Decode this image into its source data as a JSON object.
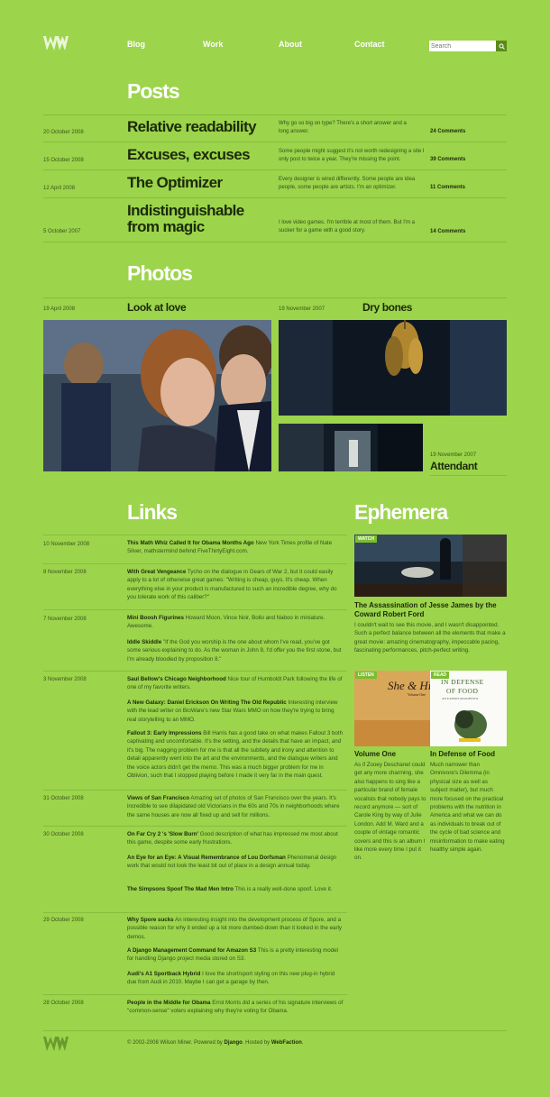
{
  "header": {
    "nav": [
      "Blog",
      "Work",
      "About",
      "Contact"
    ],
    "search_placeholder": "Search"
  },
  "posts": {
    "heading": "Posts",
    "items": [
      {
        "date": "20 October 2008",
        "title": "Relative readability",
        "excerpt": "Why go so big on type? There's a short answer and a long answer.",
        "comments": "24 Comments"
      },
      {
        "date": "15 October 2008",
        "title": "Excuses, excuses",
        "excerpt": "Some people might suggest it's not worth redesigning a site I only post to twice a year. They're missing the point.",
        "comments": "39 Comments"
      },
      {
        "date": "12 April 2008",
        "title": "The Optimizer",
        "excerpt": "Every designer is wired differently. Some people are idea people, some people are artists. I'm an optimizer.",
        "comments": "11 Comments"
      },
      {
        "date": "5 October 2007",
        "title": "Indistinguishable from magic",
        "excerpt": "I love video games. I'm terrible at most of them. But I'm a sucker for a game with a good story.",
        "comments": "14 Comments"
      }
    ]
  },
  "photos": {
    "heading": "Photos",
    "items": [
      {
        "date": "19 April 2008",
        "title": "Look at love"
      },
      {
        "date": "19 November 2007",
        "title": "Dry bones"
      },
      {
        "date": "19 November 2007",
        "title": "Attendant"
      }
    ]
  },
  "links": {
    "heading": "Links",
    "groups": [
      {
        "date": "10 November 2008",
        "entries": [
          {
            "title": "This Math Whiz Called It for Obama Months Ago",
            "desc": "New York Times profile of Nate Silver, mathstermind behind FiveThirtyEight.com."
          }
        ]
      },
      {
        "date": "8 November 2008",
        "entries": [
          {
            "title": "With Great Vengeance",
            "desc": "Tycho on the dialogue in Gears of War 2, but it could easily apply to a lot of otherwise great games: \"Writing is cheap, guys. It's cheap. When everything else in your product is manufactured to such an incredible degree, why do you tolerate work of this caliber?\""
          }
        ]
      },
      {
        "date": "7 November 2008",
        "entries": [
          {
            "title": "Mini Boosh Figurines",
            "desc": "Howard Moon, Vince Noir, Bollo and Naboo in miniature. Awesome."
          },
          {
            "title": "Iddle Skiddle",
            "desc": "\"If the God you worship is the one about whom I've read, you've got some serious explaining to do. As the woman in John 8, I'd offer you the first stone, but I'm already bloodied by proposition 8.\""
          }
        ]
      },
      {
        "date": "3 November 2008",
        "entries": [
          {
            "title": "Saul Bellow's Chicago Neighborhood",
            "desc": "Nice tour of Humboldt Park following the life of one of my favorite writers."
          },
          {
            "title": "A New Galaxy: Daniel Erickson On Writing The Old Republic",
            "desc": "Interesting interview with the lead writer on BioWare's new Star Wars MMO on how they're trying to bring real storytelling to an MMO."
          },
          {
            "title": "Fallout 3: Early Impressions",
            "desc": "Bill Harris has a good take on what makes Fallout 3 both captivating and uncomfortable. It's the setting, and the details that have an impact, and it's big. The nagging problem for me is that all the subtlety and irony and attention to detail apparently went into the art and the environments, and the dialogue writers and the voice actors didn't get the memo. This was a much bigger problem for me in Oblivion, such that I stopped playing before I made it very far in the main quest."
          }
        ]
      },
      {
        "date": "31 October 2008",
        "entries": [
          {
            "title": "Views of San Francisco",
            "desc": "Amazing set of photos of San Francisco over the years. It's incredible to see dilapidated old Victorians in the 60s and 70s in neighborhoods where the same houses are now all fixed up and sell for millions."
          }
        ]
      },
      {
        "date": "30 October 2008",
        "entries": [
          {
            "title": "On Far Cry 2 's 'Slow Burn'",
            "desc": "Good description of what has impressed me most about this game, despite some early frustrations."
          },
          {
            "title": "An Eye for an Eye: A Visual Remembrance of Lou Dorfsman",
            "desc": "Phenomenal design work that would not look the least bit out of place in a design annual today."
          },
          {
            "title": "The Simpsons Spoof The Mad Men Intro",
            "desc": "This is a really well-done spoof. Love it."
          }
        ]
      },
      {
        "date": "29 October 2008",
        "entries": [
          {
            "title": "Why Spore sucks",
            "desc": "An interesting insight into the development process of Spore, and a possible reason for why it ended up a lot more dumbed-down than it looked in the early demos."
          },
          {
            "title": "A Django Management Command for Amazon S3",
            "desc": "This is a pretty interesting model for handling Django project media stored on S3."
          },
          {
            "title": "Audi's A1 Sportback Hybrid",
            "desc": "I love the short/sport styling on this new plug-in hybrid due from Audi in 2010. Maybe I can get a garage by then."
          }
        ]
      },
      {
        "date": "28 October 2008",
        "entries": [
          {
            "title": "People in the Middle for Obama",
            "desc": "Errol Morris did a series of his signature interviews of \"common-sense\" voters explaining why they're voting for Obama."
          }
        ]
      }
    ]
  },
  "ephemera": {
    "heading": "Ephemera",
    "watch": {
      "badge": "Watch",
      "title": "The Assassination of Jesse James by the Coward Robert Ford",
      "body": "I couldn't wait to see this movie, and I wasn't disappointed. Such a perfect balance between all the elements that make a great movie: amazing cinematography, impeccable pacing, fascinating performances, pitch-perfect writing."
    },
    "listen": {
      "badge": "Listen",
      "title": "Volume One",
      "cover_text": "She & Him",
      "cover_sub": "Volume One",
      "body": "As if Zooey Deschanel could get any more charming, she also happens to sing like a particular brand of female vocalists that nobody pays to record anymore — sort of Carole King by way of Julie London. Add M. Ward and a couple of vintage romantic covers and this is an album I like more every time I put it on."
    },
    "read": {
      "badge": "Read",
      "title": "In Defense of Food",
      "cover_line1": "IN DEFENSE",
      "cover_line2": "OF FOOD",
      "cover_sub": "AN EATER'S MANIFESTO",
      "body": "Much narrower than Omnivore's Dilemma (in physical size as well as subject matter), but much more focused on the practical problems with the nutrition in America and what we can do as individuals to break out of the cycle of bad science and misinformation to make eating healthy simple again."
    }
  },
  "footer": {
    "prefix": "© 2002-2008 Wilson Miner. Powered by ",
    "django": "Django",
    "mid": ". Hosted by ",
    "webfaction": "WebFaction",
    "suffix": "."
  }
}
